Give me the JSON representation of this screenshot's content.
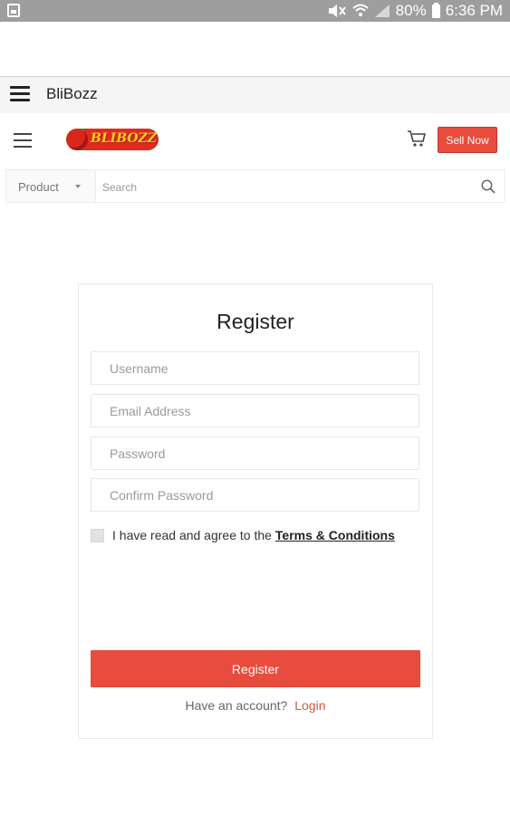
{
  "status_bar": {
    "battery": "80%",
    "time": "6:36 PM"
  },
  "app_bar": {
    "title": "BliBozz"
  },
  "header": {
    "logo_text": "BLIBOZZ",
    "sell_now_label": "Sell Now"
  },
  "search": {
    "category": "Product",
    "placeholder": "Search"
  },
  "register": {
    "title": "Register",
    "username_placeholder": "Username",
    "email_placeholder": "Email Address",
    "password_placeholder": "Password",
    "confirm_password_placeholder": "Confirm Password",
    "terms_text": "I have read and agree to the",
    "terms_link": "Terms & Conditions",
    "button_label": "Register",
    "have_account_text": "Have an account?",
    "login_label": "Login"
  },
  "colors": {
    "accent": "#e74c3c",
    "status_bar": "#9e9e9e"
  }
}
